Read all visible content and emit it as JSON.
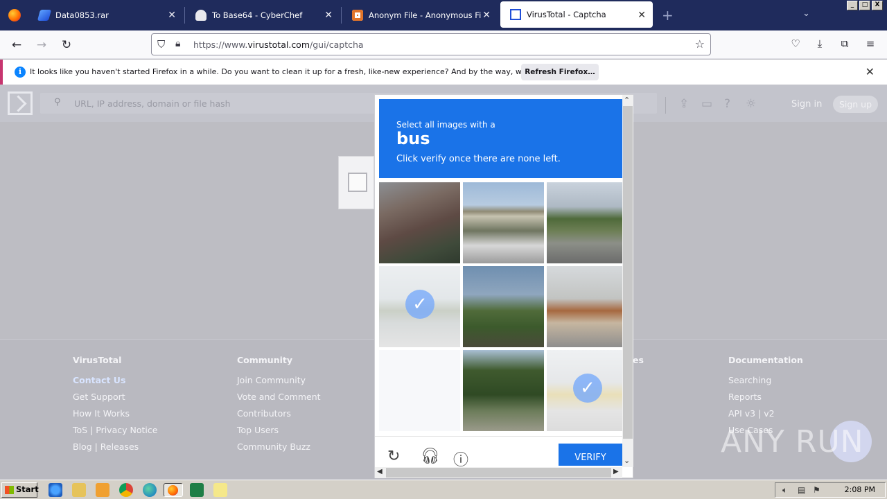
{
  "browser": {
    "tabs": [
      {
        "title": "Data0853.rar",
        "active": false
      },
      {
        "title": "To Base64 - CyberChef",
        "active": false
      },
      {
        "title": "Anonym File - Anonymous File Uplo",
        "active": false
      },
      {
        "title": "VirusTotal - Captcha",
        "active": true
      }
    ],
    "url_prefix": "https://www.",
    "url_domain": "virustotal.com",
    "url_path": "/gui/captcha",
    "window_buttons": [
      "_",
      "□",
      "X"
    ]
  },
  "notification": {
    "message": "It looks like you haven't started Firefox in a while. Do you want to clean it up for a fresh, like-new experience? And by the way, welcome back!",
    "button_label": "Refresh Firefox…"
  },
  "vt": {
    "search_placeholder": "URL, IP address, domain or file hash",
    "sign_in": "Sign in",
    "sign_up": "Sign up"
  },
  "footer": {
    "columns": [
      {
        "heading": "VirusTotal",
        "links": [
          "Contact Us",
          "Get Support",
          "How It Works",
          "ToS | Privacy Notice",
          "Blog | Releases"
        ]
      },
      {
        "heading": "Community",
        "links": [
          "Join Community",
          "Vote and Comment",
          "Contributors",
          "Top Users",
          "Community Buzz"
        ]
      },
      {
        "heading": "es",
        "links": []
      },
      {
        "heading": "Documentation",
        "links": [
          "Searching",
          "Reports",
          "API v3 | v2",
          "Use Cases"
        ]
      }
    ]
  },
  "captcha": {
    "line1": "Select all images with a",
    "target": "bus",
    "line3": "Click verify once there are none left.",
    "verify_label": "VERIFY",
    "selected_tiles": [
      3,
      8
    ],
    "faded_tiles": [
      6
    ]
  },
  "watermark": "ANY RUN",
  "taskbar": {
    "start_label": "Start",
    "clock": "2:08 PM"
  }
}
